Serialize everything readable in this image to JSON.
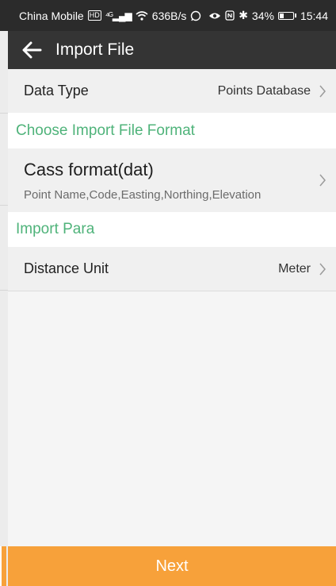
{
  "status_bar": {
    "carrier": "China Mobile",
    "speed": "636B/s",
    "battery": "34%",
    "time": "15:44"
  },
  "toolbar": {
    "title": "Import File",
    "back_icon": "arrow-left-icon"
  },
  "data_type": {
    "label": "Data Type",
    "value": "Points Database"
  },
  "format_section": {
    "header": "Choose Import File Format",
    "format_title": "Cass format(dat)",
    "format_fields": "Point Name,Code,Easting,Northing,Elevation"
  },
  "para_section": {
    "header": "Import Para",
    "distance_label": "Distance Unit",
    "distance_value": "Meter"
  },
  "footer": {
    "next_label": "Next"
  },
  "colors": {
    "accent": "#4fb37a",
    "button": "#f7a13a",
    "toolbar": "#343434",
    "status_bar": "#2b2b2b"
  }
}
